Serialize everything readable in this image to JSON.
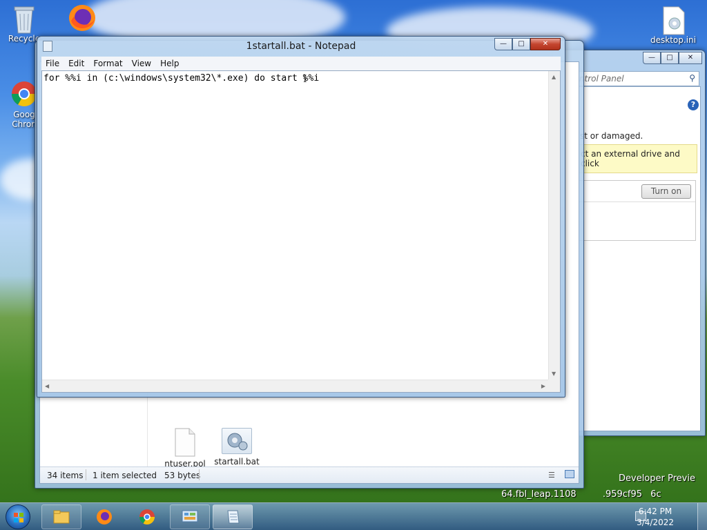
{
  "desktop": {
    "icons": [
      {
        "label": "Recycle"
      },
      {
        "label": "Goog\nChron"
      },
      {
        "label": "desktop.ini"
      }
    ],
    "watermark_line1": "Developer Previe",
    "watermark_line2": "64.fbl_leap.1108",
    "watermark_line3": ".959cf95",
    "watermark_line4": "6c"
  },
  "explorer": {
    "files": [
      {
        "label": "ntuser.pol"
      },
      {
        "label": "startall.bat"
      }
    ],
    "status": {
      "item_count": "34 items",
      "selected": "1 item selected",
      "size": "53 bytes"
    }
  },
  "control_panel": {
    "search_placeholder": "e Control Panel",
    "text_damaged": "st or damaged.",
    "warning_text": "ct an external drive and click",
    "turn_on_label": "Turn on",
    "partial_d": "d",
    "partial_at": "at"
  },
  "notepad": {
    "title": "1startall.bat - Notepad",
    "menu": [
      "File",
      "Edit",
      "Format",
      "View",
      "Help"
    ],
    "content": "for %%i in (c:\\windows\\system32\\*.exe) do start %%i"
  },
  "taskbar": {
    "time": "6:42 PM",
    "date": "3/4/2022"
  },
  "icons": {
    "help": "help-icon",
    "search": "search-icon",
    "minimize": "minimize-icon",
    "maximize": "maximize-icon",
    "close": "close-icon"
  }
}
